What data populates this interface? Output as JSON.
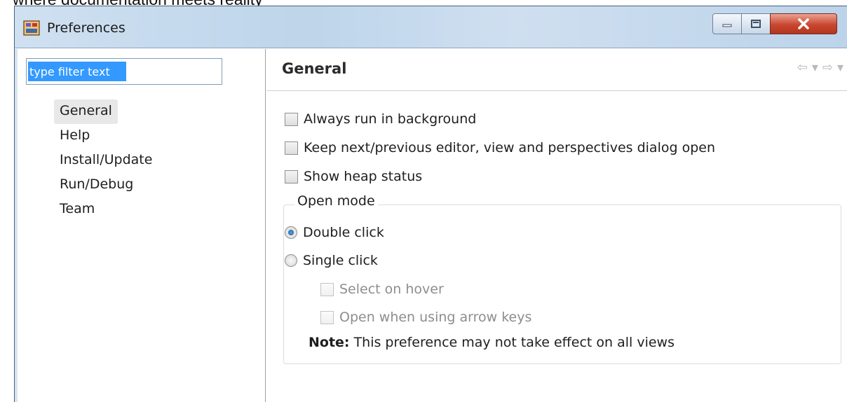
{
  "caption": "where documentation meets reality",
  "window": {
    "title": "Preferences",
    "close_glyph": "X",
    "minimize_glyph": "—",
    "maximize_glyph": "▫"
  },
  "filter": {
    "value": "type filter text"
  },
  "nav_items": [
    {
      "label": "General",
      "selected": true
    },
    {
      "label": "Help"
    },
    {
      "label": "Install/Update"
    },
    {
      "label": "Run/Debug"
    },
    {
      "label": "Team"
    }
  ],
  "page": {
    "title": "General",
    "back_glyph": "⇦",
    "forward_glyph": "⇨",
    "menu_glyph": "▾"
  },
  "options": {
    "always_run_background": "Always run in background",
    "keep_dialog_open": "Keep next/previous editor, view and perspectives dialog open",
    "show_heap_status": "Show heap status"
  },
  "open_mode": {
    "label": "Open mode",
    "double_click": "Double click",
    "single_click": "Single click",
    "select_on_hover": "Select on hover",
    "open_arrow_keys": "Open when using arrow keys",
    "note_label": "Note:",
    "note_text": " This preference may not take effect on all views"
  },
  "icons": {
    "app": "preferences-icon",
    "back": "back-arrow-icon",
    "forward": "forward-arrow-icon"
  }
}
